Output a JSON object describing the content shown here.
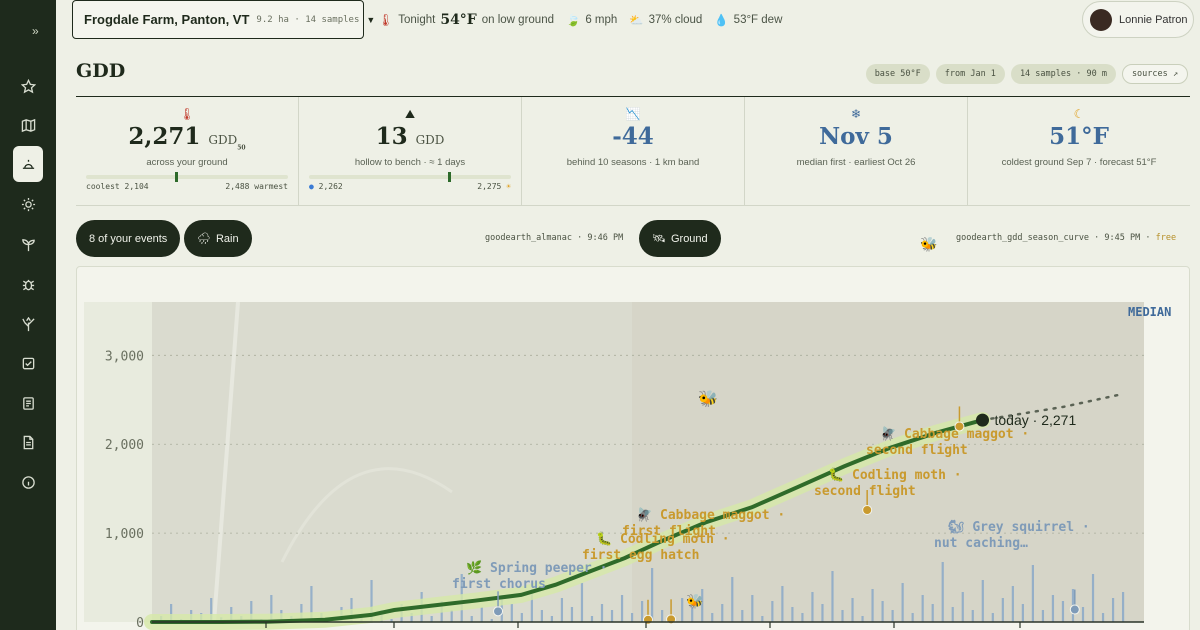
{
  "farm": {
    "name": "Frogdale Farm, Panton, VT",
    "meta": "9.2 ha · 14 samples",
    "caret": "▼"
  },
  "weather": {
    "tonight_prefix": "Tonight",
    "tonight_temp": "54°F",
    "tonight_suffix": "on low ground",
    "wind": "6 mph",
    "cloud": "37% cloud",
    "dew": "53°F dew"
  },
  "user": {
    "name": "Lonnie Patron"
  },
  "page": {
    "title": "GDD"
  },
  "pills": [
    "base 50°F",
    "from Jan 1",
    "14 samples · 90 m",
    "sources ↗"
  ],
  "stats": [
    {
      "value": "2,271",
      "unit": "GDD",
      "unit_sub": "50",
      "label": "across your ground",
      "left": "coolest 2,104",
      "right": "2,488 warmest",
      "marker": 0.44
    },
    {
      "value": "13",
      "unit": "GDD",
      "label": "hollow to bench · ≈ 1 days",
      "left": "2,262",
      "right": "2,275",
      "marker": 0.69
    },
    {
      "value": "-44",
      "label": "behind 10 seasons · 1 km band"
    },
    {
      "value": "Nov 5",
      "label": "median first · earliest Oct 26"
    },
    {
      "value": "51°F",
      "label": "coldest ground Sep 7 · forecast 51°F"
    }
  ],
  "controls": {
    "events": "8 of your events",
    "rain": "Rain",
    "almanac_source": "goodearth_almanac",
    "almanac_time": "9:46 PM",
    "ground": "Ground",
    "curve_source": "goodearth_gdd_season_curve",
    "curve_time": "9:45 PM",
    "curve_tier": "free"
  },
  "chart_data": {
    "type": "line",
    "ylim": [
      0,
      3600
    ],
    "yticks": [
      0,
      1000,
      2000,
      3000
    ],
    "ytick_labels": [
      "0",
      "1,000",
      "2,000",
      "3,000"
    ],
    "median_label": "MEDIAN",
    "series": [
      {
        "values": [
          [
            0,
            0
          ],
          [
            60,
            0
          ],
          [
            100,
            3
          ],
          [
            150,
            25
          ],
          [
            190,
            80
          ],
          [
            210,
            135
          ],
          [
            240,
            180
          ],
          [
            280,
            240
          ],
          [
            320,
            305
          ],
          [
            350,
            420
          ],
          [
            380,
            570
          ],
          [
            410,
            720
          ],
          [
            440,
            900
          ],
          [
            480,
            1120
          ],
          [
            520,
            1290
          ],
          [
            560,
            1520
          ],
          [
            600,
            1750
          ],
          [
            640,
            1960
          ],
          [
            680,
            2130
          ],
          [
            720,
            2271
          ]
        ]
      }
    ],
    "today": {
      "day": 720,
      "value": 2271,
      "label": "today · 2,271"
    },
    "forecast": [
      [
        720,
        2271
      ],
      [
        790,
        2420
      ],
      [
        840,
        2560
      ]
    ],
    "events": [
      {
        "label": "Spring peeper · first chorus",
        "day": 300,
        "value": 120,
        "color": "blue"
      },
      {
        "label": "Cabbage maggot · first flight",
        "day": 450,
        "value": 30,
        "color": "gold"
      },
      {
        "label": "Codling moth · first egg hatch",
        "day": 430,
        "value": 25,
        "color": "gold"
      },
      {
        "label": "Codling moth · second flight",
        "day": 620,
        "value": 1260,
        "color": "gold"
      },
      {
        "label": "Cabbage maggot · second flight",
        "day": 700,
        "value": 2200,
        "color": "gold"
      },
      {
        "label": "Grey squirrel · nut caching…",
        "day": 800,
        "value": 140,
        "color": "blue"
      }
    ],
    "rain_bars": [
      0.1,
      0.3,
      0.05,
      0.2,
      0.15,
      0.4,
      0.08,
      0.25,
      0.1,
      0.35,
      0.05,
      0.45,
      0.2,
      0.1,
      0.3,
      0.6,
      0.15,
      0.05,
      0.25,
      0.4,
      0.1,
      0.7,
      0.2,
      0.05,
      0.3,
      0.15,
      0.5,
      0.1,
      0.35,
      0.2,
      0.8,
      0.1,
      0.25,
      0.05,
      0.45,
      0.3,
      0.15,
      0.55,
      0.2,
      0.1,
      0.4,
      0.25,
      0.65,
      0.1,
      0.3,
      0.2,
      0.45,
      0.15,
      0.35,
      0.9,
      0.2,
      0.1,
      0.4,
      0.25,
      0.55,
      0.15,
      0.3,
      0.75,
      0.2,
      0.45,
      0.1,
      0.35,
      0.6,
      0.25,
      0.15,
      0.5,
      0.3,
      0.85,
      0.2,
      0.4,
      0.1,
      0.55,
      0.35,
      0.2,
      0.65,
      0.15,
      0.45,
      0.3,
      1.0,
      0.25,
      0.5,
      0.2,
      0.7,
      0.15,
      0.4,
      0.6,
      0.3,
      0.95,
      0.2,
      0.45,
      0.35,
      0.55,
      0.25,
      0.8,
      0.15,
      0.4,
      0.5
    ]
  }
}
